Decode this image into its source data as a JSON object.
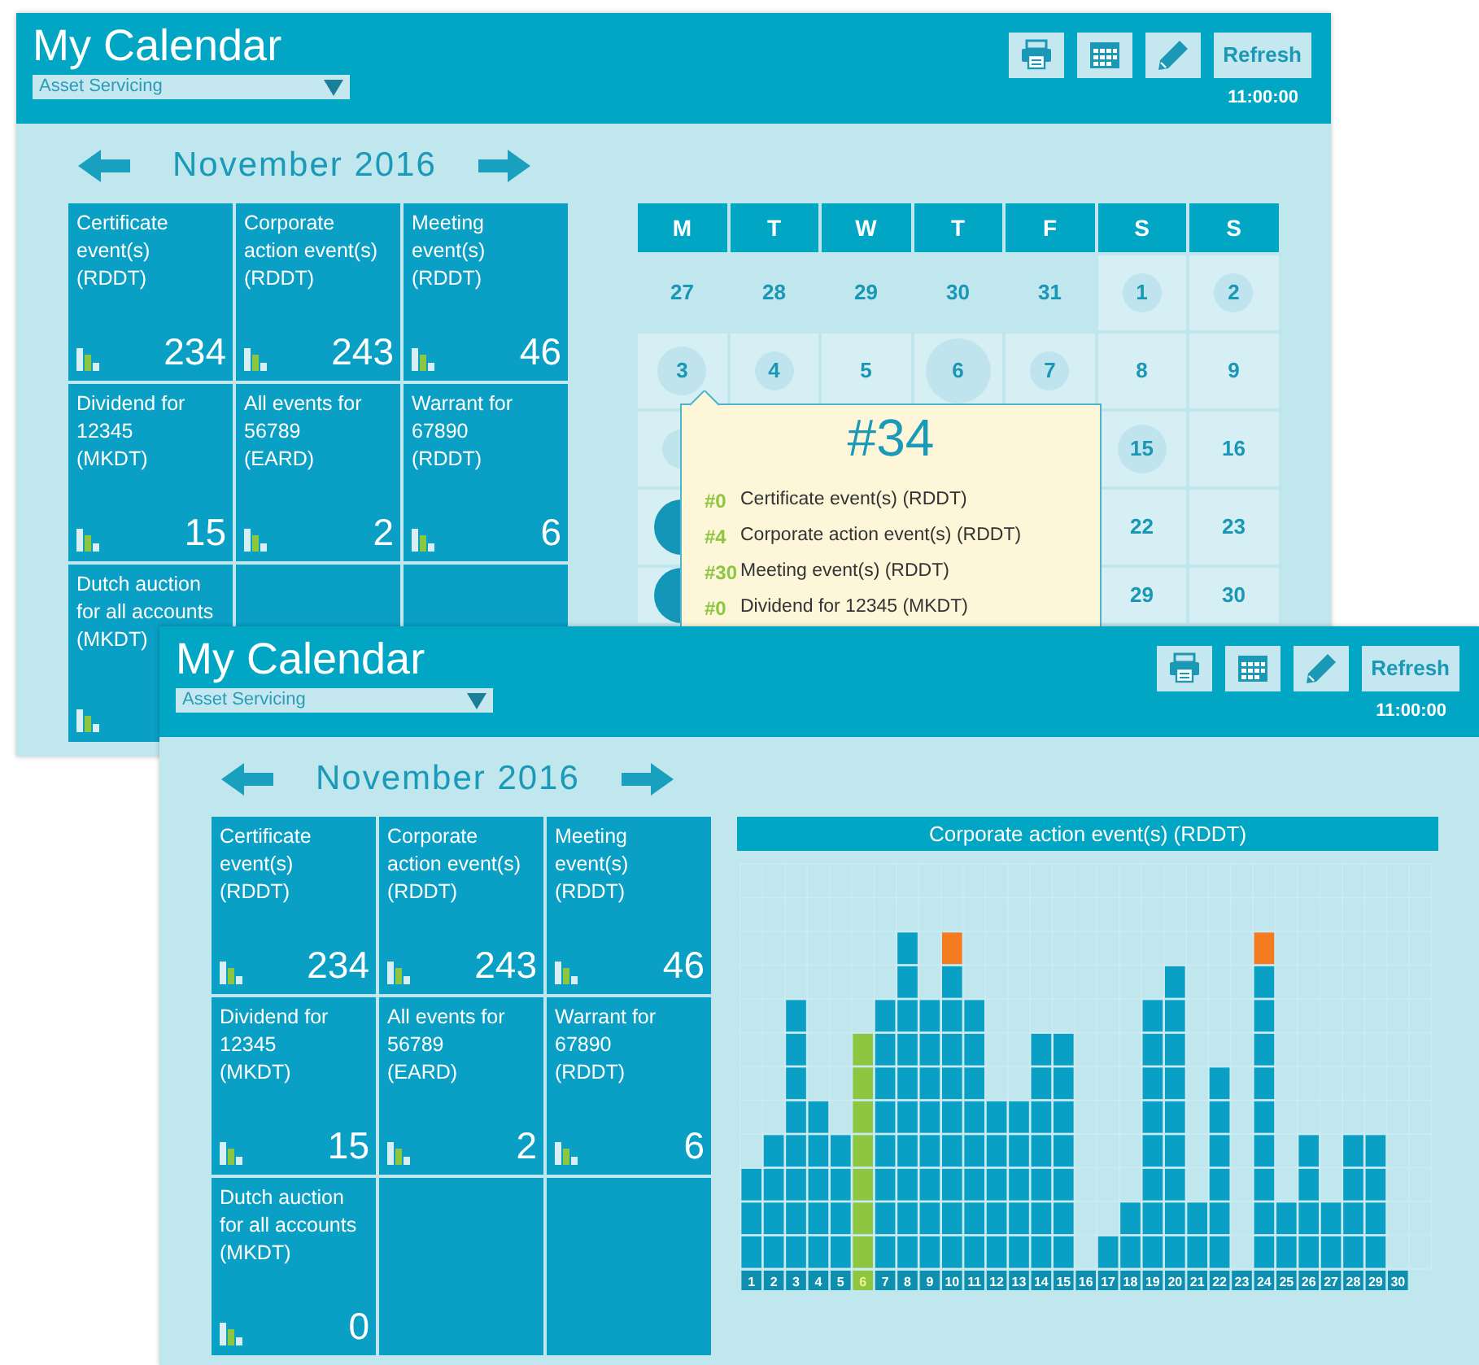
{
  "windows": [
    {
      "title": "My Calendar",
      "selector": {
        "value": "Asset Servicing"
      },
      "toolbar": [
        {
          "kind": "print"
        },
        {
          "kind": "calendar"
        },
        {
          "kind": "edit"
        },
        {
          "kind": "refresh",
          "label": "Refresh"
        }
      ],
      "time": "11:00:00",
      "month": "November 2016",
      "tiles": [
        {
          "kind": "event",
          "label": "Certificate\nevent(s)\n(RDDT)",
          "count": "234"
        },
        {
          "kind": "event",
          "label": "Corporate\naction event(s)\n(RDDT)",
          "count": "243"
        },
        {
          "kind": "event",
          "label": "Meeting\nevent(s)\n(RDDT)",
          "count": "46"
        },
        {
          "kind": "event",
          "label": "Dividend for\n12345\n(MKDT)",
          "count": "15"
        },
        {
          "kind": "event",
          "label": "All events for\n56789\n(EARD)",
          "count": "2"
        },
        {
          "kind": "event",
          "label": "Warrant for\n67890\n(RDDT)",
          "count": "6"
        },
        {
          "kind": "event",
          "label": "Dutch auction\nfor all accounts\n(MKDT)"
        },
        {
          "kind": "empty"
        },
        {
          "kind": "empty"
        }
      ],
      "calendar": {
        "weekdays": [
          "M",
          "T",
          "W",
          "T",
          "F",
          "S",
          "S"
        ],
        "weeks": [
          [
            {
              "day": "27",
              "outside": true,
              "kind": "plain"
            },
            {
              "day": "28",
              "outside": true,
              "kind": "plain"
            },
            {
              "day": "29",
              "outside": true,
              "kind": "plain"
            },
            {
              "day": "30",
              "outside": true,
              "kind": "plain"
            },
            {
              "day": "31",
              "outside": true,
              "kind": "plain"
            },
            {
              "day": "1",
              "outside": false,
              "kind": "small"
            },
            {
              "day": "2",
              "outside": false,
              "kind": "small"
            }
          ],
          [
            {
              "day": "3",
              "outside": false,
              "kind": "medium"
            },
            {
              "day": "4",
              "outside": false,
              "kind": "small"
            },
            {
              "day": "5",
              "outside": false,
              "kind": "plain"
            },
            {
              "day": "6",
              "outside": false,
              "kind": "large"
            },
            {
              "day": "7",
              "outside": false,
              "kind": "small"
            },
            {
              "day": "8",
              "outside": false,
              "kind": "plain"
            },
            {
              "day": "9",
              "outside": false,
              "kind": "plain"
            }
          ],
          [
            {
              "outside": false,
              "kind": "small"
            },
            {
              "kind": "blank"
            },
            {
              "kind": "blank"
            },
            {
              "kind": "blank"
            },
            {
              "kind": "blank"
            },
            {
              "day": "15",
              "outside": false,
              "kind": "medium"
            },
            {
              "day": "16",
              "outside": false,
              "kind": "plain"
            }
          ],
          [
            {
              "outside": false,
              "kind": "filled"
            },
            {
              "kind": "blank"
            },
            {
              "kind": "blank"
            },
            {
              "kind": "blank"
            },
            {
              "kind": "blank"
            },
            {
              "day": "22",
              "outside": false,
              "kind": "plain"
            },
            {
              "day": "23",
              "outside": false,
              "kind": "plain"
            }
          ],
          [
            {
              "outside": false,
              "kind": "filled"
            },
            {
              "kind": "blank"
            },
            {
              "kind": "blank"
            },
            {
              "kind": "blank"
            },
            {
              "kind": "blank"
            },
            {
              "day": "29",
              "outside": false,
              "kind": "plain"
            },
            {
              "day": "30",
              "outside": false,
              "kind": "plain"
            }
          ]
        ]
      },
      "tooltip": {
        "total": "#34",
        "items": [
          {
            "count": "#0",
            "label": "Certificate event(s) (RDDT)"
          },
          {
            "count": "#4",
            "label": "Corporate action event(s) (RDDT)"
          },
          {
            "count": "#30",
            "label": "Meeting event(s) (RDDT)"
          },
          {
            "count": "#0",
            "label": "Dividend for 12345 (MKDT)"
          }
        ]
      }
    },
    {
      "title": "My Calendar",
      "selector": {
        "value": "Asset Servicing"
      },
      "toolbar": [
        {
          "kind": "print"
        },
        {
          "kind": "calendar"
        },
        {
          "kind": "edit"
        },
        {
          "kind": "refresh",
          "label": "Refresh"
        }
      ],
      "time": "11:00:00",
      "month": "November 2016",
      "tiles": [
        {
          "kind": "event",
          "label": "Certificate\nevent(s)\n(RDDT)",
          "count": "234"
        },
        {
          "kind": "event",
          "label": "Corporate\naction event(s)\n(RDDT)",
          "count": "243"
        },
        {
          "kind": "event",
          "label": "Meeting\nevent(s)\n(RDDT)",
          "count": "46"
        },
        {
          "kind": "event",
          "label": "Dividend for\n12345\n(MKDT)",
          "count": "15"
        },
        {
          "kind": "event",
          "label": "All events for\n56789\n(EARD)",
          "count": "2"
        },
        {
          "kind": "event",
          "label": "Warrant for\n67890\n(RDDT)",
          "count": "6"
        },
        {
          "kind": "event",
          "label": "Dutch auction\nfor all accounts\n(MKDT)",
          "count": "0"
        },
        {
          "kind": "empty"
        },
        {
          "kind": "empty"
        }
      ],
      "chart": {
        "title": "Corporate action event(s) (RDDT)",
        "day_labels": [
          {
            "label": "1",
            "selected": false
          },
          {
            "label": "2",
            "selected": false
          },
          {
            "label": "3",
            "selected": false
          },
          {
            "label": "4",
            "selected": false
          },
          {
            "label": "5",
            "selected": false
          },
          {
            "label": "6",
            "selected": true
          },
          {
            "label": "7",
            "selected": false
          },
          {
            "label": "8",
            "selected": false
          },
          {
            "label": "9",
            "selected": false
          },
          {
            "label": "10",
            "selected": false
          },
          {
            "label": "11",
            "selected": false
          },
          {
            "label": "12",
            "selected": false
          },
          {
            "label": "13",
            "selected": false
          },
          {
            "label": "14",
            "selected": false
          },
          {
            "label": "15",
            "selected": false
          },
          {
            "label": "16",
            "selected": false
          },
          {
            "label": "17",
            "selected": false
          },
          {
            "label": "18",
            "selected": false
          },
          {
            "label": "19",
            "selected": false
          },
          {
            "label": "20",
            "selected": false
          },
          {
            "label": "21",
            "selected": false
          },
          {
            "label": "22",
            "selected": false
          },
          {
            "label": "23",
            "selected": false
          },
          {
            "label": "24",
            "selected": false
          },
          {
            "label": "25",
            "selected": false
          },
          {
            "label": "26",
            "selected": false
          },
          {
            "label": "27",
            "selected": false
          },
          {
            "label": "28",
            "selected": false
          },
          {
            "label": "29",
            "selected": false
          },
          {
            "label": "30",
            "selected": false
          }
        ]
      }
    }
  ]
}
